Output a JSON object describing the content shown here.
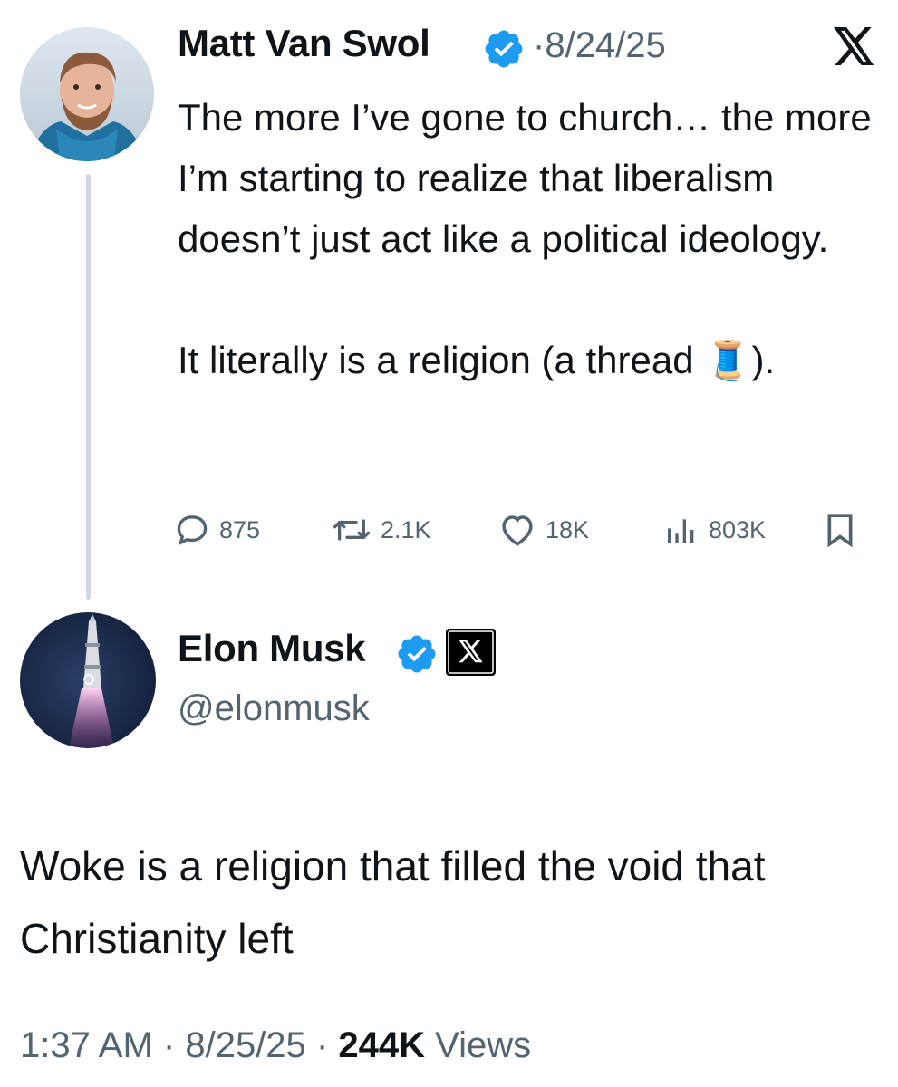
{
  "original_tweet": {
    "author_name": "Matt Van Swol",
    "separator": "·",
    "date": "8/24/25",
    "text": "The more I’ve gone to church… the more I’m starting to realize that liberalism doesn’t just act like a political ideology.\n\nIt literally is a religion (a thread 🧵).",
    "stats": {
      "replies": "875",
      "reposts": "2.1K",
      "likes": "18K",
      "views": "803K"
    },
    "avatar_icon": "bearded-man-avatar",
    "verified_icon": "verified-badge-icon",
    "platform_icon": "x-logo-icon"
  },
  "reply_tweet": {
    "author_name": "Elon Musk",
    "handle": "@elonmusk",
    "text": "Woke is a religion that filled the void that Christianity left",
    "timestamp": "1:37 AM",
    "separator": "·",
    "date": "8/25/25",
    "views_count": "244K",
    "views_label": "Views",
    "avatar_icon": "rocket-launch-avatar",
    "verified_icon": "verified-badge-icon",
    "affiliation_icon": "x-logo-badge-icon"
  },
  "colors": {
    "verified_blue": "#1d9bf0",
    "secondary_text": "#536471",
    "primary_text": "#0f1419",
    "thread_line": "#cfd9de"
  }
}
